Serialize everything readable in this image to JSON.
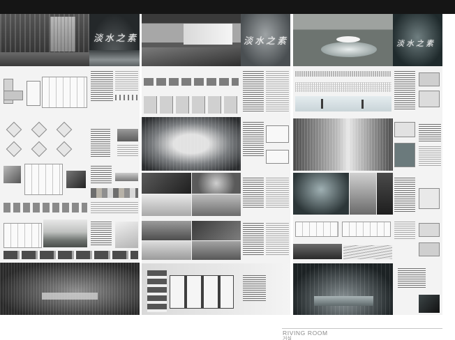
{
  "board": {
    "panels": [
      {
        "logo_text": "淡水之素"
      },
      {
        "logo_text": "淡水之素"
      },
      {
        "logo_text": "淡水之素"
      }
    ]
  },
  "footer": {
    "title": "RIVING ROOM",
    "subtitle": "거실"
  },
  "colors": {
    "top_bar": "#151515",
    "panel_background": "#f3f3f3",
    "render_dark": "#2e2e2e",
    "label_grey": "#8a8a8a"
  }
}
